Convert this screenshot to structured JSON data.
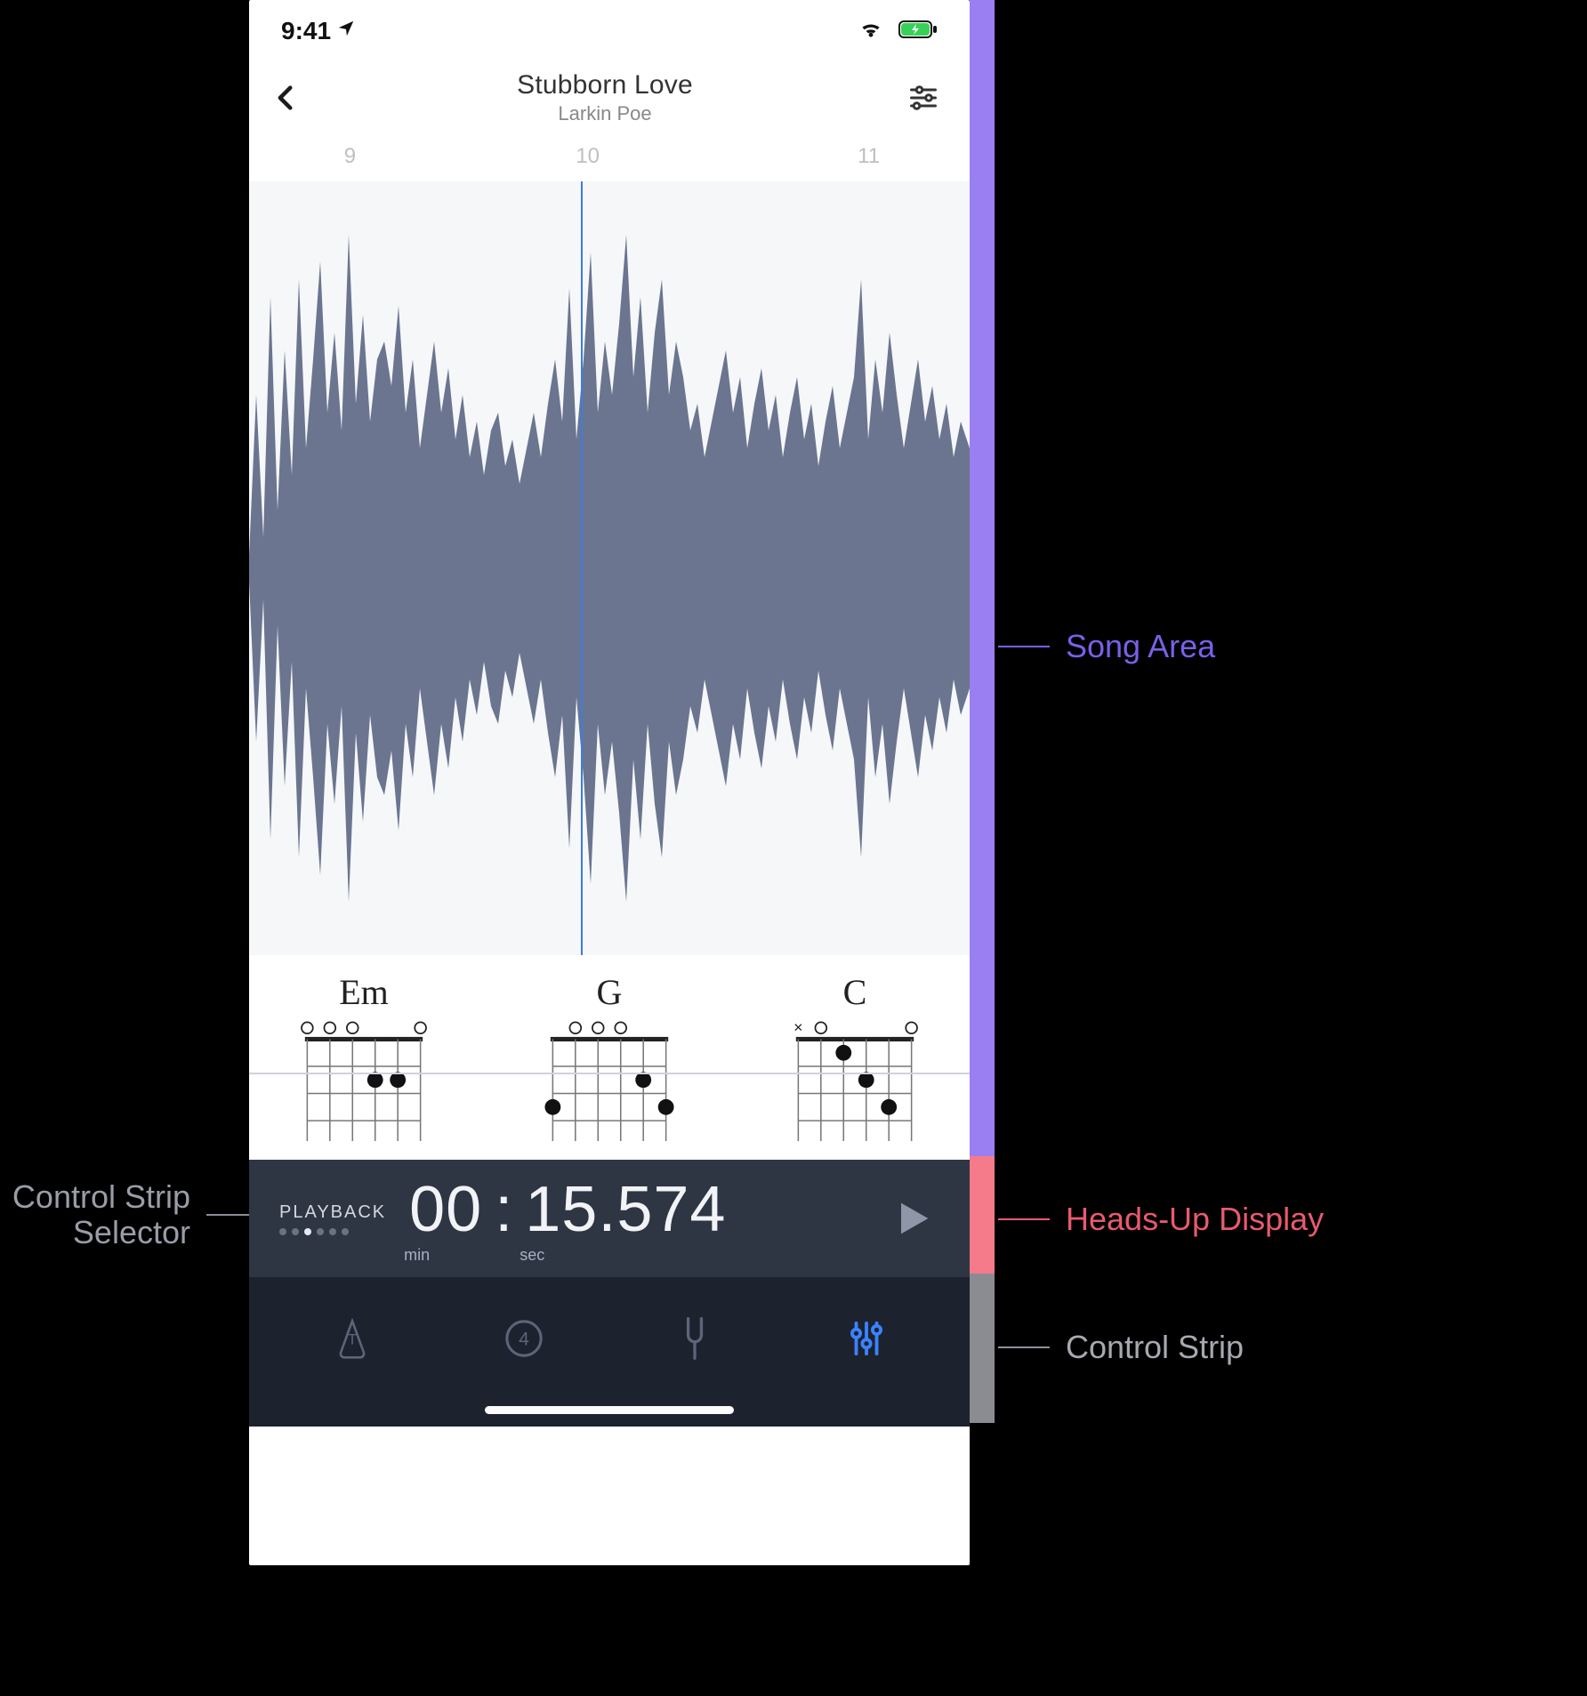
{
  "status": {
    "time": "9:41"
  },
  "header": {
    "title": "Stubborn Love",
    "artist": "Larkin Poe"
  },
  "ruler": {
    "marks": [
      "9",
      "10",
      "11"
    ]
  },
  "chords": [
    {
      "name": "Em",
      "frets": [
        [
          2,
          2
        ],
        [
          2,
          3
        ]
      ],
      "open": [
        1,
        4,
        5,
        6
      ],
      "mute": []
    },
    {
      "name": "G",
      "frets": [
        [
          2,
          2
        ],
        [
          3,
          1
        ],
        [
          3,
          6
        ]
      ],
      "open": [
        3,
        4,
        5
      ],
      "mute": []
    },
    {
      "name": "C",
      "frets": [
        [
          1,
          4
        ],
        [
          2,
          3
        ],
        [
          3,
          2
        ]
      ],
      "open": [
        1,
        5
      ],
      "mute": [
        6
      ]
    }
  ],
  "hud": {
    "label": "PLAYBACK",
    "dots_total": 6,
    "dots_active": 2,
    "min": "00",
    "sec": "15",
    "ms": "574",
    "unit_min": "min",
    "unit_sec": "sec"
  },
  "callouts": {
    "song": "Song Area",
    "hud": "Heads-Up Display",
    "strip": "Control Strip",
    "selector_l1": "Control Strip",
    "selector_l2": "Selector"
  },
  "colors": {
    "purple": "#9a7ff2",
    "pink": "#f57a8a",
    "gray": "#8a8c92",
    "accent": "#3c82ff",
    "wave": "#6b7590"
  }
}
